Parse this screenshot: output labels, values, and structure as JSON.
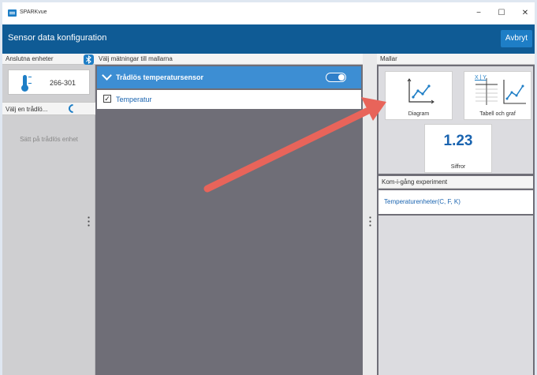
{
  "app": {
    "name": "SPARKvue"
  },
  "window_controls": {
    "minimize": "−",
    "maximize": "☐",
    "close": "✕"
  },
  "header": {
    "title": "Sensor data konfiguration",
    "cancel_label": "Avbryt"
  },
  "left_panel": {
    "header": "Anslutna enheter",
    "device_id": "266-301",
    "wireless_label": "Välj en trådlö...",
    "wireless_hint": "Sätt på trådlös enhet"
  },
  "middle_panel": {
    "header": "Välj mätningar till mallarna",
    "sensor_name": "Trådlös temperatursensor",
    "sensor_enabled": true,
    "measurement": "Temperatur",
    "measurement_checked": true
  },
  "right_panel": {
    "header": "Mallar",
    "templates": [
      {
        "label": "Diagram",
        "icon": "graph-icon"
      },
      {
        "label": "Tabell och graf",
        "icon": "table-graph-icon",
        "table_header": "X | Y"
      },
      {
        "label": "Siffror",
        "icon": "digits-icon",
        "value_text": "1.23"
      }
    ],
    "quickstart_header": "Kom-i-gång experiment",
    "quickstart_items": [
      "Temperaturenheter(C, F, K)"
    ]
  },
  "annotation": {
    "type": "arrow",
    "color": "#e8645a"
  },
  "colors": {
    "header_blue": "#0f5b95",
    "accent_blue": "#1e7ec6",
    "selected_row": "#3d8ed3",
    "dark_panel": "#6f6e77",
    "arrow": "#e8645a"
  }
}
